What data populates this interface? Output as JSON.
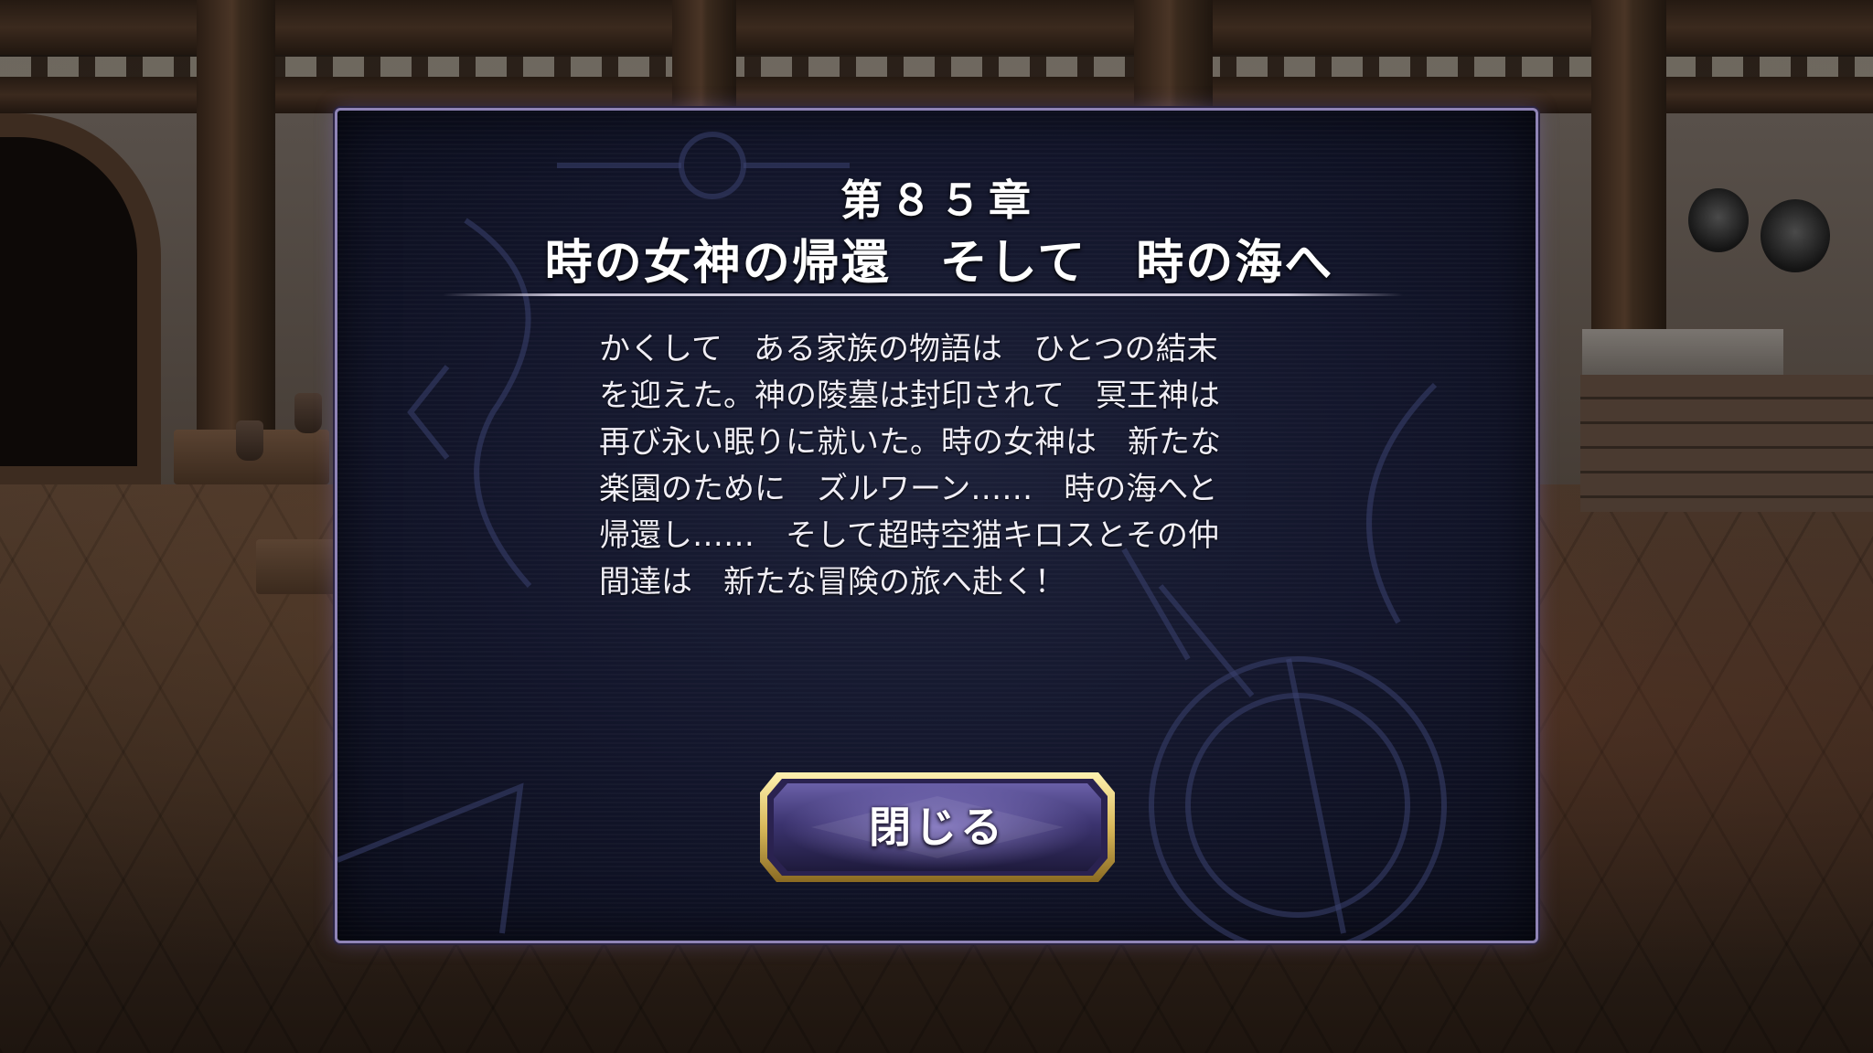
{
  "dialog": {
    "chapter_number": "第８５章",
    "chapter_title": "時の女神の帰還　そして　時の海へ",
    "story_lines": [
      "かくして　ある家族の物語は　ひとつの結末",
      "を迎えた。神の陵墓は封印されて　冥王神は",
      "再び永い眠りに就いた。時の女神は　新たな",
      "楽園のために　ズルワーン……　時の海へと",
      "帰還し……　そして超時空猫キロスとその仲",
      "間達は　新たな冒険の旅へ赴く！"
    ],
    "close_label": "閉じる"
  },
  "colors": {
    "dialog_border": "#8f84b6",
    "dialog_background": "#12152a",
    "button_frame_gold": "#d8b85a",
    "button_fill": "#3c3470",
    "text": "#ffffff"
  },
  "icons": {
    "dialog_ornament": "clock-ornament-icon"
  }
}
